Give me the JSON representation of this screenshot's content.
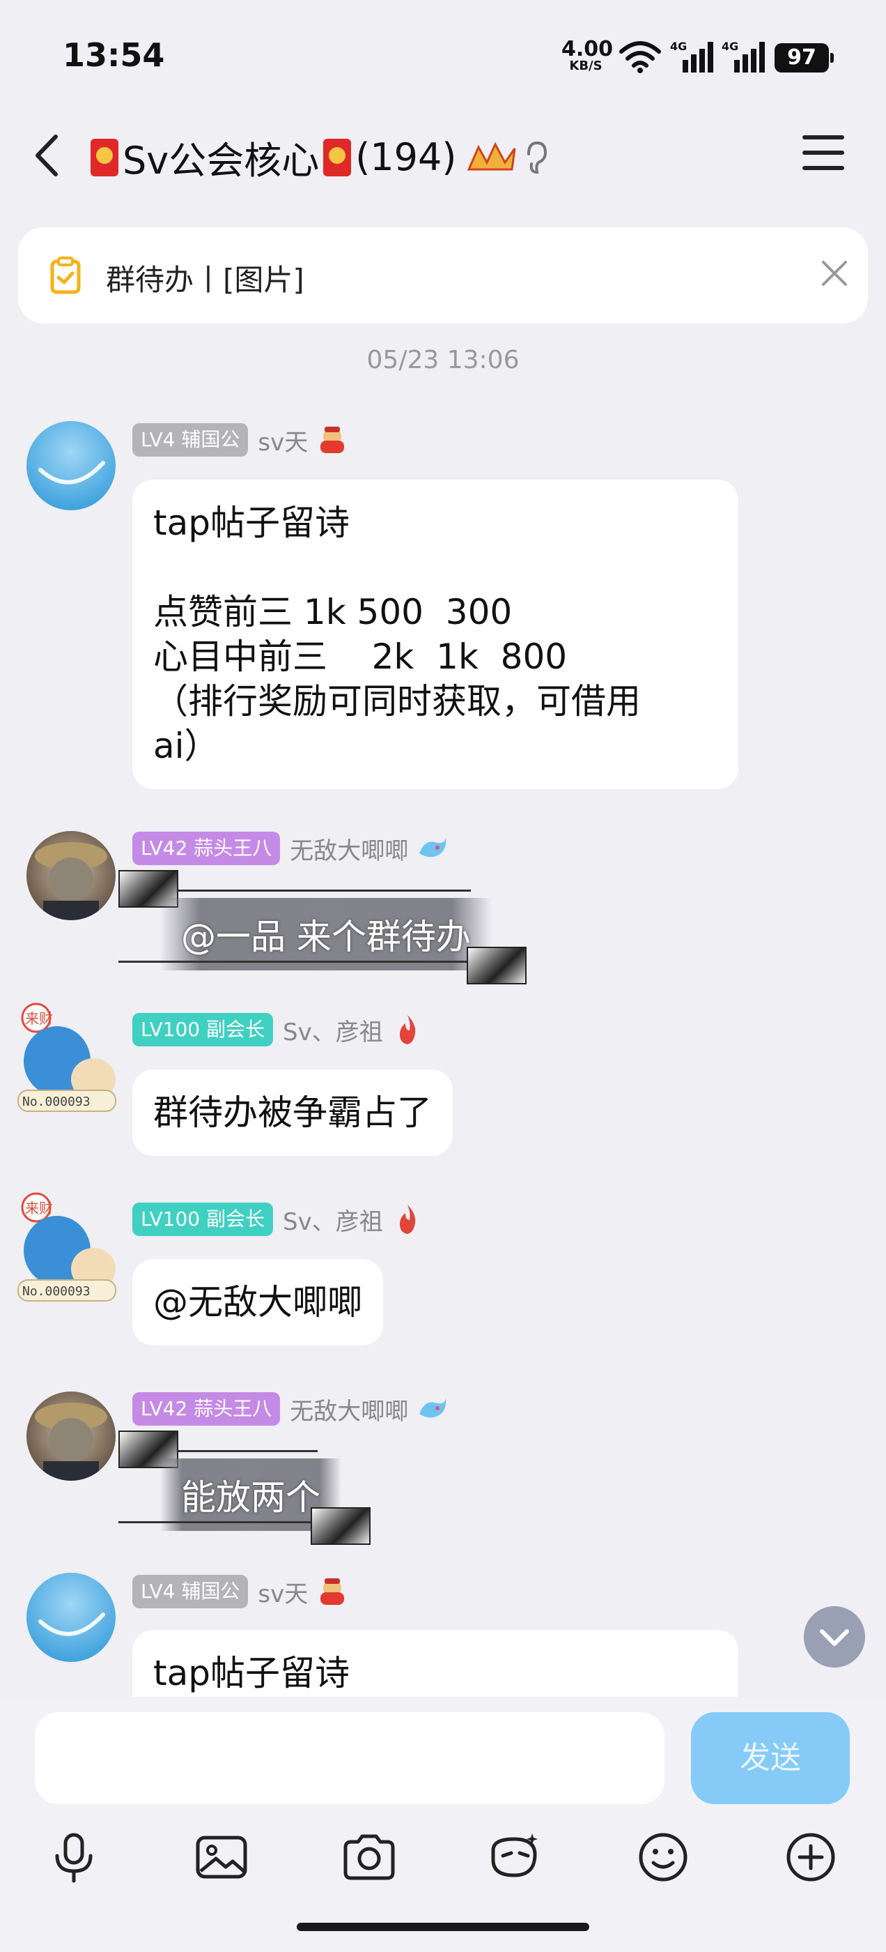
{
  "status_bar": {
    "time": "13:54",
    "net_speed": "4.00",
    "net_speed_unit": "KB/S",
    "battery": "97"
  },
  "header": {
    "title_prefix": "Sv公会核心",
    "member_count": "(194)"
  },
  "todo_banner": {
    "text": "群待办丨[图片]"
  },
  "timestamp": "05/23 13:06",
  "messages": [
    {
      "level": "LV4 辅国公",
      "nickname": "sv天",
      "text": "tap帖子留诗\n\n点赞前三 1k 500  300\n心目中前三    2k  1k  800\n（排行奖励可同时获取，可借用\nai）"
    },
    {
      "level": "LV42 蒜头王八",
      "nickname": "无敌大唧唧",
      "text": "@一品 来个群待办"
    },
    {
      "level": "LV100 副会长",
      "nickname": "Sv、彦祖",
      "text": "群待办被争霸占了"
    },
    {
      "level": "LV100 副会长",
      "nickname": "Sv、彦祖",
      "text": "@无敌大唧唧"
    },
    {
      "level": "LV42 蒜头王八",
      "nickname": "无敌大唧唧",
      "text": "能放两个"
    },
    {
      "level": "LV4 辅国公",
      "nickname": "sv天",
      "text": "tap帖子留诗"
    }
  ],
  "input": {
    "placeholder": "",
    "send_label": "发送"
  },
  "colors": {
    "send_button": "#86cbf8",
    "badge_gray": "#b3b3b8",
    "badge_purple": "#c58ae6",
    "badge_teal": "#3fd0c2"
  }
}
